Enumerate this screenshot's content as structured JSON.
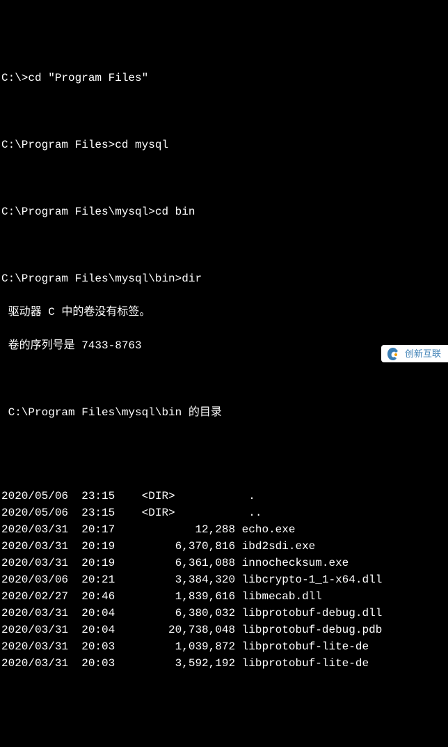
{
  "cmds": [
    {
      "prompt": "C:\\>",
      "input": "cd \"Program Files\""
    },
    {
      "prompt": "C:\\Program Files>",
      "input": "cd mysql"
    },
    {
      "prompt": "C:\\Program Files\\mysql>",
      "input": "cd bin"
    },
    {
      "prompt": "C:\\Program Files\\mysql\\bin>",
      "input": "dir"
    }
  ],
  "vol": {
    "l1": " 驱动器 C 中的卷没有标签。",
    "l2": " 卷的序列号是 7433-8763"
  },
  "dirof": " C:\\Program Files\\mysql\\bin 的目录",
  "rows": [
    {
      "date": "2020/05/06",
      "time": "23:15",
      "size": "<DIR>         ",
      "name": "."
    },
    {
      "date": "2020/05/06",
      "time": "23:15",
      "size": "<DIR>         ",
      "name": ".."
    },
    {
      "date": "2020/03/31",
      "time": "20:17",
      "size": "12,288",
      "name": "echo.exe"
    },
    {
      "date": "2020/03/31",
      "time": "20:19",
      "size": "6,370,816",
      "name": "ibd2sdi.exe"
    },
    {
      "date": "2020/03/31",
      "time": "20:19",
      "size": "6,361,088",
      "name": "innochecksum.exe"
    },
    {
      "date": "2020/03/06",
      "time": "20:21",
      "size": "3,384,320",
      "name": "libcrypto-1_1-x64.dll"
    },
    {
      "date": "2020/02/27",
      "time": "20:46",
      "size": "1,839,616",
      "name": "libmecab.dll"
    },
    {
      "date": "2020/03/31",
      "time": "20:04",
      "size": "6,380,032",
      "name": "libprotobuf-debug.dll"
    },
    {
      "date": "2020/03/31",
      "time": "20:04",
      "size": "20,738,048",
      "name": "libprotobuf-debug.pdb"
    },
    {
      "date": "2020/03/31",
      "time": "20:03",
      "size": "1,039,872",
      "name": "libprotobuf-lite-de"
    },
    {
      "date": "2020/03/31",
      "time": "20:03",
      "size": "3,592,192",
      "name": "libprotobuf-lite-de"
    }
  ],
  "watermark": {
    "text": "创新互联"
  }
}
